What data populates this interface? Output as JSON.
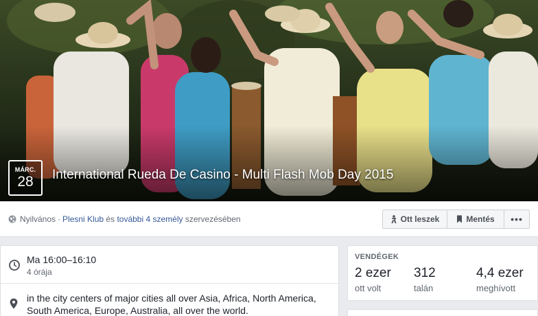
{
  "cover": {
    "date_month": "MÁRC.",
    "date_day": "28",
    "title": "International Rueda De Casino - Multi Flash Mob Day 2015"
  },
  "info_bar": {
    "privacy": "Nyilvános",
    "separator": "·",
    "host_link": "Plesni Klub",
    "and_text": "és",
    "others_link": "további 4 személy",
    "organized_text": "szervezésében",
    "going_label": "Ott leszek",
    "save_label": "Mentés",
    "more_label": "•••"
  },
  "details": {
    "time": "Ma 16:00–16:10",
    "time_ago": "4 órája",
    "location": "in the city centers of major cities all over Asia, Africa, North America, South America, Europe, Australia, all over the world."
  },
  "guests": {
    "title": "VENDÉGEK",
    "stats": [
      {
        "value": "2 ezer",
        "label": "ott volt"
      },
      {
        "value": "312",
        "label": "talán"
      },
      {
        "value": "4,4 ezer",
        "label": "meghívott"
      }
    ]
  },
  "colors": {
    "link": "#365899",
    "muted": "#606770",
    "background": "#e9ebee"
  }
}
